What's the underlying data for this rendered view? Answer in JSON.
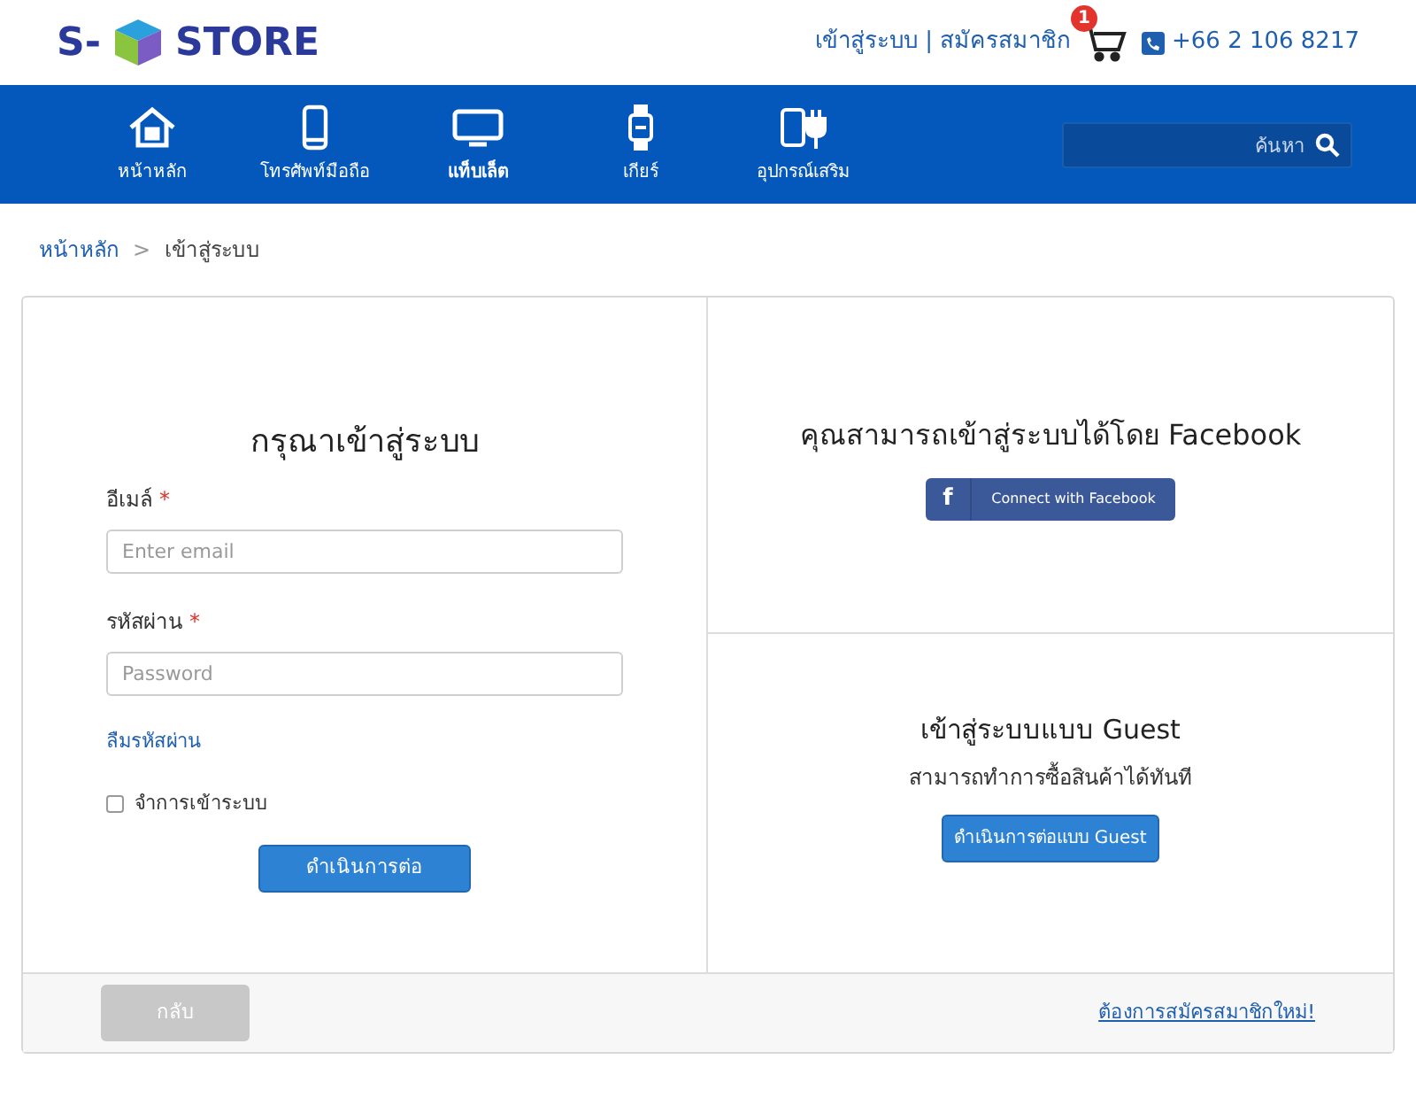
{
  "header": {
    "logo": {
      "left": "S-",
      "right": "STORE"
    },
    "login_link": "เข้าสู่ระบบ",
    "separator": "|",
    "register_link": "สมัครสมาชิก",
    "cart_count": "1",
    "phone": "+66 2 106 8217"
  },
  "nav": {
    "items": [
      {
        "kind": "home",
        "label": "หน้าหลัก",
        "selected": false
      },
      {
        "kind": "phone",
        "label": "โทรศัพท์มือถือ",
        "selected": false
      },
      {
        "kind": "tablet",
        "label": "แท็บเล็ต",
        "selected": true
      },
      {
        "kind": "watch",
        "label": "เกียร์",
        "selected": false
      },
      {
        "kind": "plug",
        "label": "อุปกรณ์เสริม",
        "selected": false
      }
    ],
    "search": {
      "placeholder": "ค้นหา"
    }
  },
  "breadcrumb": [
    {
      "label": "หน้าหลัก",
      "link": true
    },
    {
      "label": "เข้าสู่ระบบ",
      "link": false
    }
  ],
  "breadcrumb_separator": ">",
  "login": {
    "title": "กรุณาเข้าสู่ระบบ",
    "fields": [
      {
        "label": "อีเมล์",
        "required": "*",
        "placeholder": "Enter email"
      },
      {
        "label": "รหัสผ่าน",
        "required": "*",
        "placeholder": "Password"
      }
    ],
    "forgot_link": "ลืมรหัสผ่าน",
    "remember": {
      "label": "จำการเข้าระบบ",
      "checked": false
    },
    "submit": "ดำเนินการต่อ"
  },
  "facebook": {
    "title": "คุณสามารถเข้าสู่ระบบได้โดย Facebook",
    "icon_letter": "f",
    "button": "Connect with Facebook"
  },
  "guest": {
    "title": "เข้าสู่ระบบแบบ Guest",
    "subtitle": "สามารถทำการซื้อสินค้าได้ทันที",
    "button": "ดำเนินการต่อแบบ Guest"
  },
  "footer": {
    "back_button": "กลับ",
    "register_link": "ต้องการสมัครสมาชิกใหม่!"
  }
}
